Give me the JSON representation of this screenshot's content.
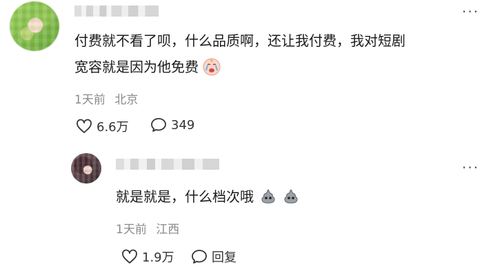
{
  "main_comment": {
    "line1": "付费就不看了呗，什么品质啊，还让我付费，我对短剧",
    "line2": "宽容就是因为他免费",
    "emoji": "crying-face-icon",
    "time": "1天前",
    "location": "北京",
    "likes": "6.6万",
    "comments": "349",
    "more": "···"
  },
  "reply": {
    "text": "就是就是，什么档次哦",
    "emojis": [
      "poop-icon",
      "poop-icon"
    ],
    "time": "1天前",
    "location": "江西",
    "likes": "1.9万",
    "reply_label": "回复",
    "more": "···"
  }
}
